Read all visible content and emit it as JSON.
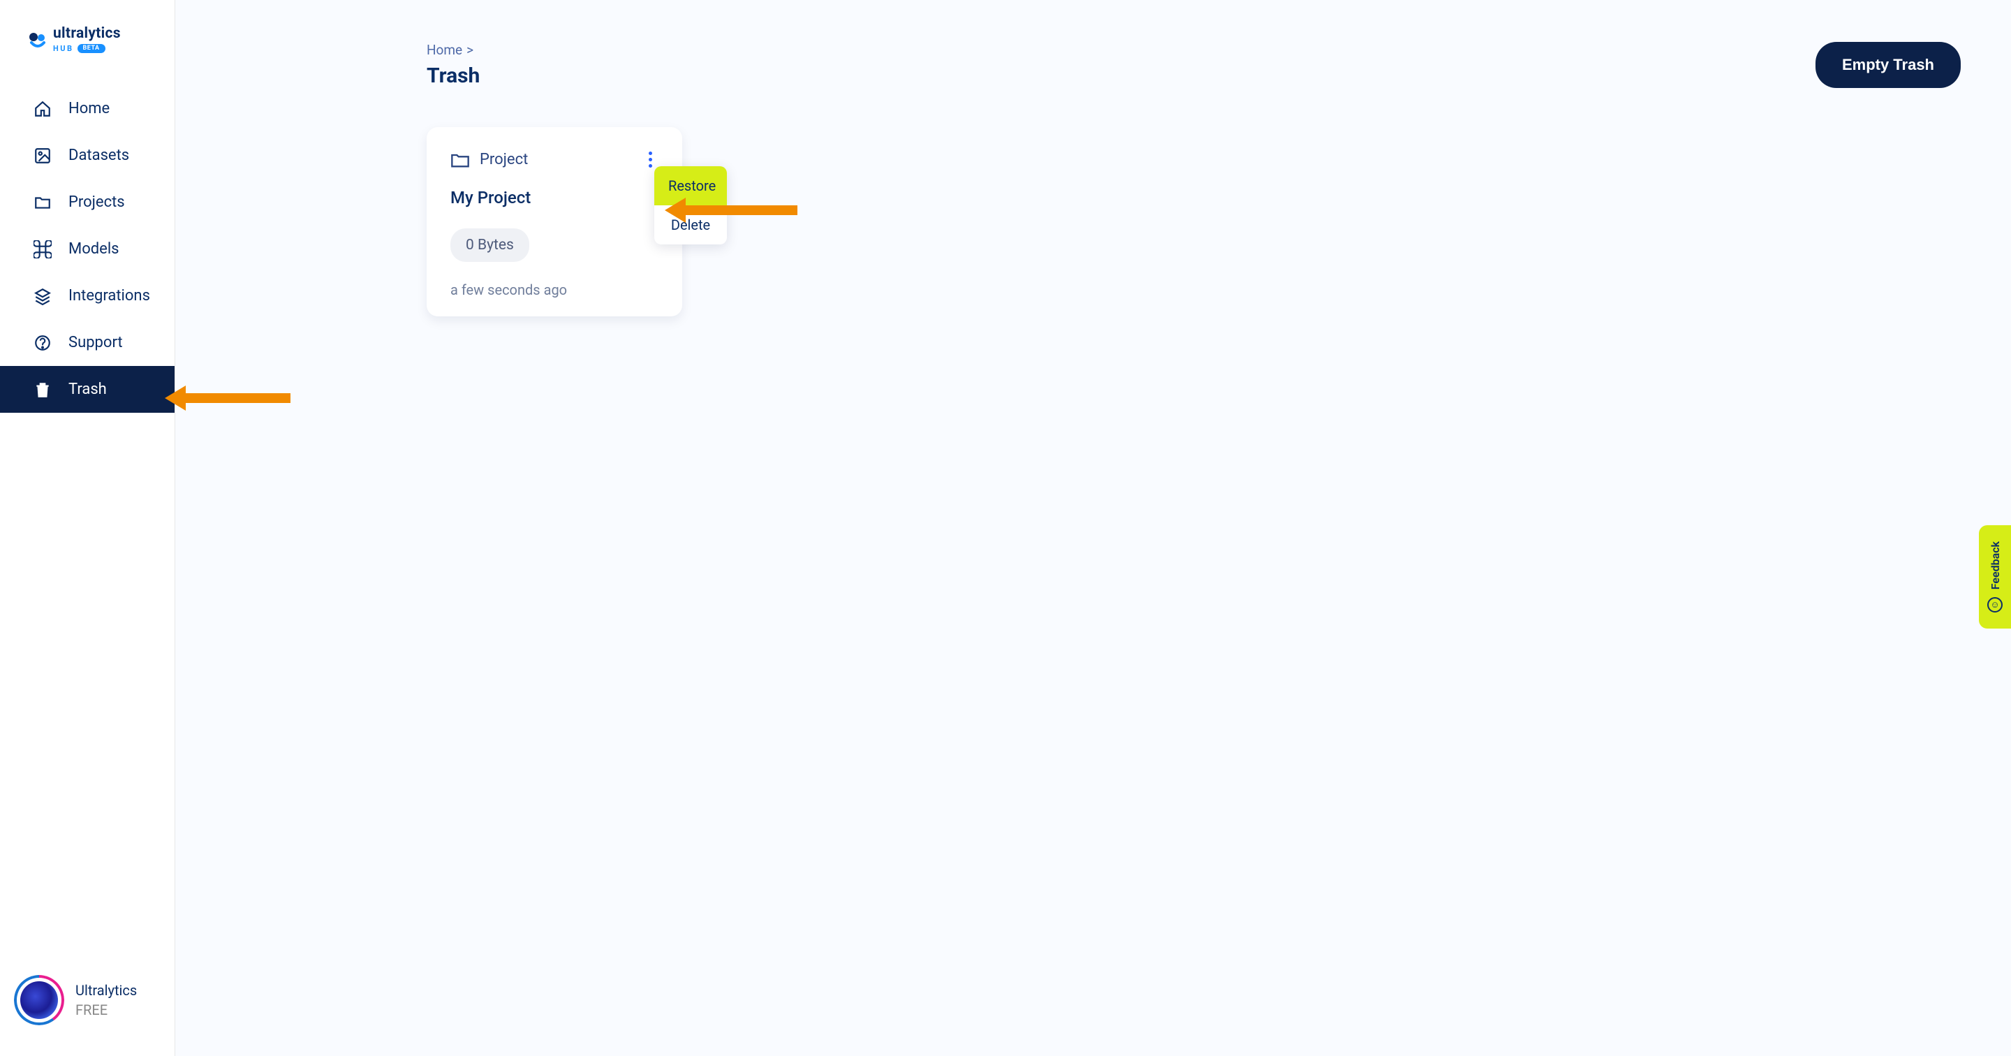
{
  "brand": {
    "name": "ultralytics",
    "hub_label": "HUB",
    "beta_label": "BETA"
  },
  "sidebar": {
    "items": [
      {
        "label": "Home",
        "icon": "home-icon"
      },
      {
        "label": "Datasets",
        "icon": "image-icon"
      },
      {
        "label": "Projects",
        "icon": "folder-icon"
      },
      {
        "label": "Models",
        "icon": "command-icon"
      },
      {
        "label": "Integrations",
        "icon": "layers-icon"
      },
      {
        "label": "Support",
        "icon": "help-icon"
      },
      {
        "label": "Trash",
        "icon": "trash-icon"
      }
    ]
  },
  "user": {
    "name": "Ultralytics",
    "plan": "FREE"
  },
  "breadcrumb": {
    "home": "Home",
    "sep": ">"
  },
  "page": {
    "title": "Trash"
  },
  "actions": {
    "empty_trash": "Empty Trash"
  },
  "card": {
    "type_label": "Project",
    "title": "My Project",
    "size": "0 Bytes",
    "time": "a few seconds ago",
    "menu": {
      "restore": "Restore",
      "delete": "Delete"
    }
  },
  "feedback": {
    "label": "Feedback"
  }
}
